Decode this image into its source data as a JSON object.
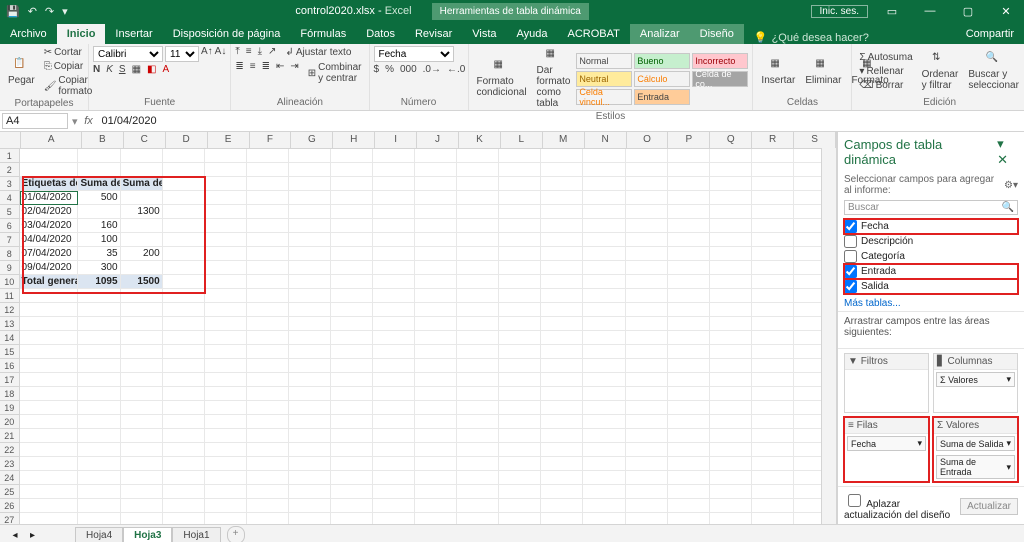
{
  "title": {
    "filename": "control2020.xlsx",
    "app": "Excel",
    "context_tool": "Herramientas de tabla dinámica",
    "signin": "Inic. ses."
  },
  "menus": {
    "file": "Archivo",
    "home": "Inicio",
    "insert": "Insertar",
    "layout": "Disposición de página",
    "formulas": "Fórmulas",
    "data": "Datos",
    "review": "Revisar",
    "view": "Vista",
    "help": "Ayuda",
    "acrobat": "ACROBAT",
    "analyze": "Analizar",
    "design": "Diseño",
    "tell": "¿Qué desea hacer?",
    "share": "Compartir"
  },
  "ribbon": {
    "clipboard": {
      "label": "Portapapeles",
      "cut": "Cortar",
      "copy": "Copiar",
      "paste": "Pegar",
      "format_painter": "Copiar formato"
    },
    "font": {
      "label": "Fuente",
      "name": "Calibri",
      "size": "11"
    },
    "align": {
      "label": "Alineación",
      "wrap": "Ajustar texto",
      "merge": "Combinar y centrar"
    },
    "number": {
      "label": "Número",
      "format": "Fecha"
    },
    "styles": {
      "label": "Estilos",
      "cond": "Formato condicional",
      "table": "Dar formato como tabla",
      "s_normal": "Normal",
      "s_bueno": "Bueno",
      "s_incorrecto": "Incorrecto",
      "s_neutral": "Neutral",
      "s_calculo": "Cálculo",
      "s_celdaco": "Celda de co...",
      "s_celdavin": "Celda vincul...",
      "s_entrada": "Entrada"
    },
    "cells": {
      "label": "Celdas",
      "insert": "Insertar",
      "delete": "Eliminar",
      "format": "Formato"
    },
    "editing": {
      "label": "Edición",
      "autosum": "Autosuma",
      "fill": "Rellenar",
      "clear": "Borrar",
      "sort": "Ordenar y filtrar",
      "find": "Buscar y seleccionar"
    }
  },
  "fx": {
    "cell_ref": "A4",
    "formula": "01/04/2020"
  },
  "grid": {
    "cols": [
      "A",
      "B",
      "C",
      "D",
      "E",
      "F",
      "G",
      "H",
      "I",
      "J",
      "K",
      "L",
      "M",
      "N",
      "O",
      "P",
      "Q",
      "R",
      "S"
    ],
    "rowcount": 28,
    "headers": [
      "Etiquetas de fila",
      "Suma de Salida",
      "Suma de Entrada"
    ],
    "data": [
      {
        "a": "01/04/2020",
        "b": "500",
        "c": ""
      },
      {
        "a": "02/04/2020",
        "b": "",
        "c": "1300"
      },
      {
        "a": "03/04/2020",
        "b": "160",
        "c": ""
      },
      {
        "a": "04/04/2020",
        "b": "100",
        "c": ""
      },
      {
        "a": "07/04/2020",
        "b": "35",
        "c": "200"
      },
      {
        "a": "09/04/2020",
        "b": "300",
        "c": ""
      }
    ],
    "total": {
      "label": "Total general",
      "b": "1095",
      "c": "1500"
    }
  },
  "pane": {
    "title": "Campos de tabla dinámica",
    "subtitle": "Seleccionar campos para agregar al informe:",
    "search": "Buscar",
    "fields": [
      {
        "name": "Fecha",
        "checked": true,
        "boxed": true
      },
      {
        "name": "Descripción",
        "checked": false,
        "boxed": false
      },
      {
        "name": "Categoría",
        "checked": false,
        "boxed": false
      },
      {
        "name": "Entrada",
        "checked": true,
        "boxed": true
      },
      {
        "name": "Salida",
        "checked": true,
        "boxed": true
      }
    ],
    "more": "Más tablas...",
    "drag_hint": "Arrastrar campos entre las áreas siguientes:",
    "areas": {
      "filters": "Filtros",
      "columns": "Columnas",
      "rows": "Filas",
      "values": "Valores"
    },
    "col_pill": "Σ Valores",
    "row_pill": "Fecha",
    "val_pills": [
      "Suma de Salida",
      "Suma de Entrada"
    ],
    "defer": "Aplazar actualización del diseño",
    "update": "Actualizar"
  },
  "sheets": {
    "s1": "Hoja4",
    "s2": "Hoja3",
    "s3": "Hoja1"
  }
}
